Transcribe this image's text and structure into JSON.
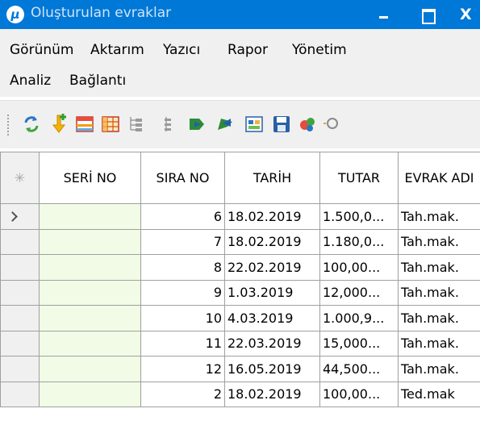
{
  "window": {
    "title": "Oluşturulan evraklar",
    "app_icon_glyph": "μ",
    "close_glyph": "X"
  },
  "menu": {
    "items": [
      "Görünüm",
      "Aktarım",
      "Yazıcı",
      "Rapor",
      "Yönetim",
      "Analiz",
      "Bağlantı"
    ]
  },
  "toolbar": {
    "icons": [
      "refresh-icon",
      "add-record-icon",
      "table-view-icon",
      "grid-view-icon",
      "tree-expand-icon",
      "tree-collapse-icon",
      "export-icon",
      "import-icon",
      "report-icon",
      "save-icon",
      "settings-icon",
      "search-icon"
    ]
  },
  "grid": {
    "select_glyph": "✳",
    "columns": [
      {
        "key": "seri",
        "label": "SERİ NO"
      },
      {
        "key": "sira",
        "label": "SIRA NO"
      },
      {
        "key": "tarih",
        "label": "TARİH"
      },
      {
        "key": "tutar",
        "label": "TUTAR"
      },
      {
        "key": "evrak",
        "label": "EVRAK ADI"
      }
    ],
    "rows": [
      {
        "seri": "",
        "sira": "6",
        "tarih": "18.02.2019",
        "tutar": "1.500,0...",
        "evrak": "Tah.mak."
      },
      {
        "seri": "",
        "sira": "7",
        "tarih": "18.02.2019",
        "tutar": "1.180,0...",
        "evrak": "Tah.mak."
      },
      {
        "seri": "",
        "sira": "8",
        "tarih": "22.02.2019",
        "tutar": "100,00...",
        "evrak": "Tah.mak."
      },
      {
        "seri": "",
        "sira": "9",
        "tarih": "1.03.2019",
        "tutar": "12,000...",
        "evrak": "Tah.mak."
      },
      {
        "seri": "",
        "sira": "10",
        "tarih": "4.03.2019",
        "tutar": "1.000,9...",
        "evrak": "Tah.mak."
      },
      {
        "seri": "",
        "sira": "11",
        "tarih": "22.03.2019",
        "tutar": "15,000...",
        "evrak": "Tah.mak."
      },
      {
        "seri": "",
        "sira": "12",
        "tarih": "16.05.2019",
        "tutar": "44,500...",
        "evrak": "Tah.mak."
      },
      {
        "seri": "",
        "sira": "2",
        "tarih": "18.02.2019",
        "tutar": "100,00...",
        "evrak": "Ted.mak"
      }
    ],
    "current_row": 0
  },
  "colors": {
    "titlebar": "#0078d7",
    "seri_cell": "#f2fbe6",
    "grid_border": "#a0a0a0"
  }
}
